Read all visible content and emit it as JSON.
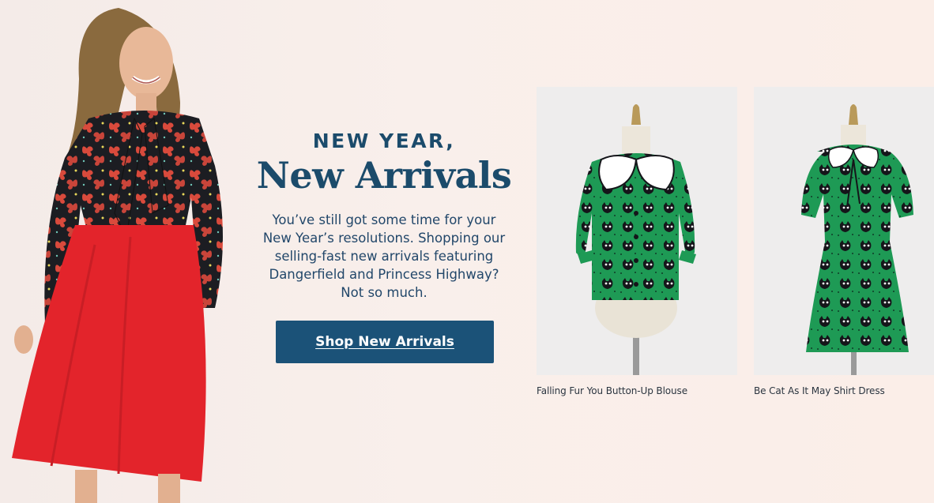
{
  "promo": {
    "eyebrow": "NEW YEAR,",
    "headline": "New Arrivals",
    "body_lines": [
      "You’ve still got some time for your",
      "New Year’s resolutions. Shopping our",
      "selling-fast new arrivals featuring",
      "Dangerfield and Princess Highway?",
      "Not so much."
    ],
    "cta_label": "Shop New Arrivals"
  },
  "hero_image": {
    "icon": "model-photo",
    "skirt_color": "#e3242b",
    "blouse_color": "#1c1d22"
  },
  "products": [
    {
      "name": "Falling Fur You Button-Up Blouse",
      "icon": "blouse-photo",
      "color": "#1e9a55"
    },
    {
      "name": "Be Cat As It May Shirt Dress",
      "icon": "dress-photo",
      "color": "#1e9a55"
    }
  ],
  "colors": {
    "brand_navy": "#1b4b6b",
    "button": "#1b5278",
    "background": "#f9efeb"
  }
}
